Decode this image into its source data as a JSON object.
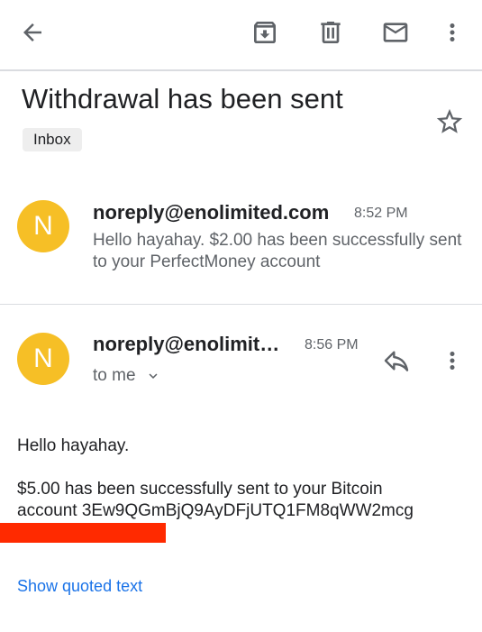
{
  "toolbar": {
    "back_icon": "arrow-back-icon",
    "archive_icon": "archive-icon",
    "delete_icon": "trash-icon",
    "mark_unread_icon": "mail-icon",
    "more_icon": "more-vert-icon"
  },
  "thread": {
    "subject": "Withdrawal has been sent",
    "label": "Inbox",
    "star_icon": "star-outline-icon"
  },
  "messages": [
    {
      "avatar_letter": "N",
      "avatar_color": "#f6bf26",
      "sender": "noreply@enolimited.com",
      "time": "8:52 PM",
      "snippet": "Hello hayahay. $2.00 has been successfully sent to your PerfectMoney account"
    },
    {
      "avatar_letter": "N",
      "avatar_color": "#f6bf26",
      "sender": "noreply@enolimit…",
      "time": "8:56 PM",
      "recipient": "to me",
      "reply_icon": "reply-icon",
      "more_icon": "more-vert-icon",
      "body": {
        "greeting": "Hello hayahay.",
        "line1": "$5.00 has been successfully sent to your Bitcoin",
        "line2": "account 3Ew9QGmBjQ9AyDFjUTQ1FM8qWW2mcg"
      },
      "show_quoted": "Show quoted text"
    }
  ],
  "colors": {
    "accent_link": "#1a73e8",
    "redaction": "#ff2a00"
  }
}
